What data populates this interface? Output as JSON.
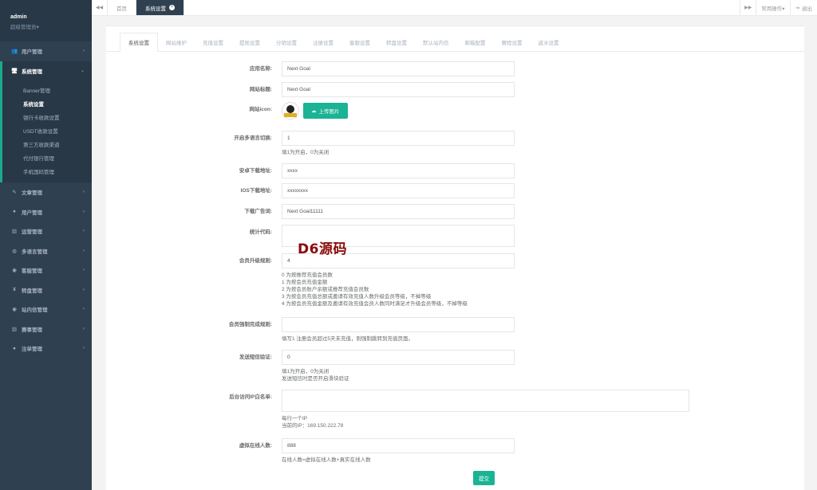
{
  "user": {
    "name": "admin",
    "role": "超级管理员▾"
  },
  "sidebar": {
    "items": [
      {
        "icon": "users-icon",
        "glyph": "👥",
        "label": "用户管理"
      },
      {
        "icon": "desktop-icon",
        "glyph": "🖥",
        "label": "系统管理"
      },
      {
        "icon": "file-icon",
        "glyph": "✎",
        "label": "文章管理"
      },
      {
        "icon": "user-icon",
        "glyph": "●",
        "label": "用户管理"
      },
      {
        "icon": "chart-icon",
        "glyph": "▥",
        "label": "运营管理"
      },
      {
        "icon": "globe-icon",
        "glyph": "◍",
        "label": "多语言管理"
      },
      {
        "icon": "chat-icon",
        "glyph": "◉",
        "label": "客服管理"
      },
      {
        "icon": "yen-icon",
        "glyph": "¥",
        "label": "转盘管理"
      },
      {
        "icon": "message-icon",
        "glyph": "◉",
        "label": "站内信管理"
      },
      {
        "icon": "bar-icon",
        "glyph": "▥",
        "label": "赛事管理"
      },
      {
        "icon": "person-icon",
        "glyph": "●",
        "label": "注单管理"
      }
    ],
    "sub_items": [
      "Banner管理",
      "系统设置",
      "银行卡收款设置",
      "USDT收款设置",
      "第三方收款渠道",
      "代付银行管理",
      "手机国码管理"
    ]
  },
  "topbar": {
    "tabs": [
      "首页",
      "系统设置"
    ],
    "ops": "常用操作▾",
    "logout": "退出"
  },
  "settings_tabs": [
    "系统设置",
    "网站维护",
    "充值设置",
    "提现设置",
    "分销设置",
    "注册设置",
    "客服设置",
    "转盘设置",
    "默认站内信",
    "邮箱配置",
    "赛程设置",
    "返水设置"
  ],
  "form": {
    "app_name": {
      "label": "应用名称:",
      "value": "Next Goal"
    },
    "site_title": {
      "label": "网站标题:",
      "value": "Next Goal"
    },
    "site_icon": {
      "label": "网站icon:",
      "button": "上传图片"
    },
    "multi_lang": {
      "label": "开启多语言切换:",
      "value": "1",
      "help": "填1为开启，0为关闭"
    },
    "android_url": {
      "label": "安卓下载地址:",
      "value": "xxxx"
    },
    "ios_url": {
      "label": "IOS下载地址:",
      "value": "xxxxxxxx"
    },
    "download_ad": {
      "label": "下载广告词:",
      "value": "Next Goal11111"
    },
    "stats_code": {
      "label": "统计代码:",
      "value": ""
    },
    "upgrade_rule": {
      "label": "会员升级规则:",
      "value": "4",
      "help": [
        "0 为按推荐充值会员数",
        "1 为按会员充值金额",
        "2 为按会员账户余额或推荐充值会员数",
        "3 为按会员充值总额或邀请有效充值人数升级会员等级，不掉等级",
        "4 为按会员充值金额及邀请有效充值会员人数同时满足才升级会员等级，不掉等级"
      ]
    },
    "force_recharge": {
      "label": "会员强制完成规则:",
      "value": "",
      "help": "填写1 注册会员超过5天未充值，则强制跳转到充值页面。"
    },
    "sms_verify": {
      "label": "发送短信验证:",
      "value": "0",
      "help": [
        "填1为开启，0为关闭",
        "发送短信时是否开启滑块验证"
      ]
    },
    "ip_whitelist": {
      "label": "后台访问IP白名单:",
      "value": "",
      "help": [
        "每行一个IP",
        "当前的IP：169.150.222.78"
      ]
    },
    "virtual_online": {
      "label": "虚拟在线人数:",
      "value": "888",
      "help": "在线人数=虚拟在线人数+真实在线人数"
    },
    "submit": "提交"
  },
  "watermark": "D6源码"
}
